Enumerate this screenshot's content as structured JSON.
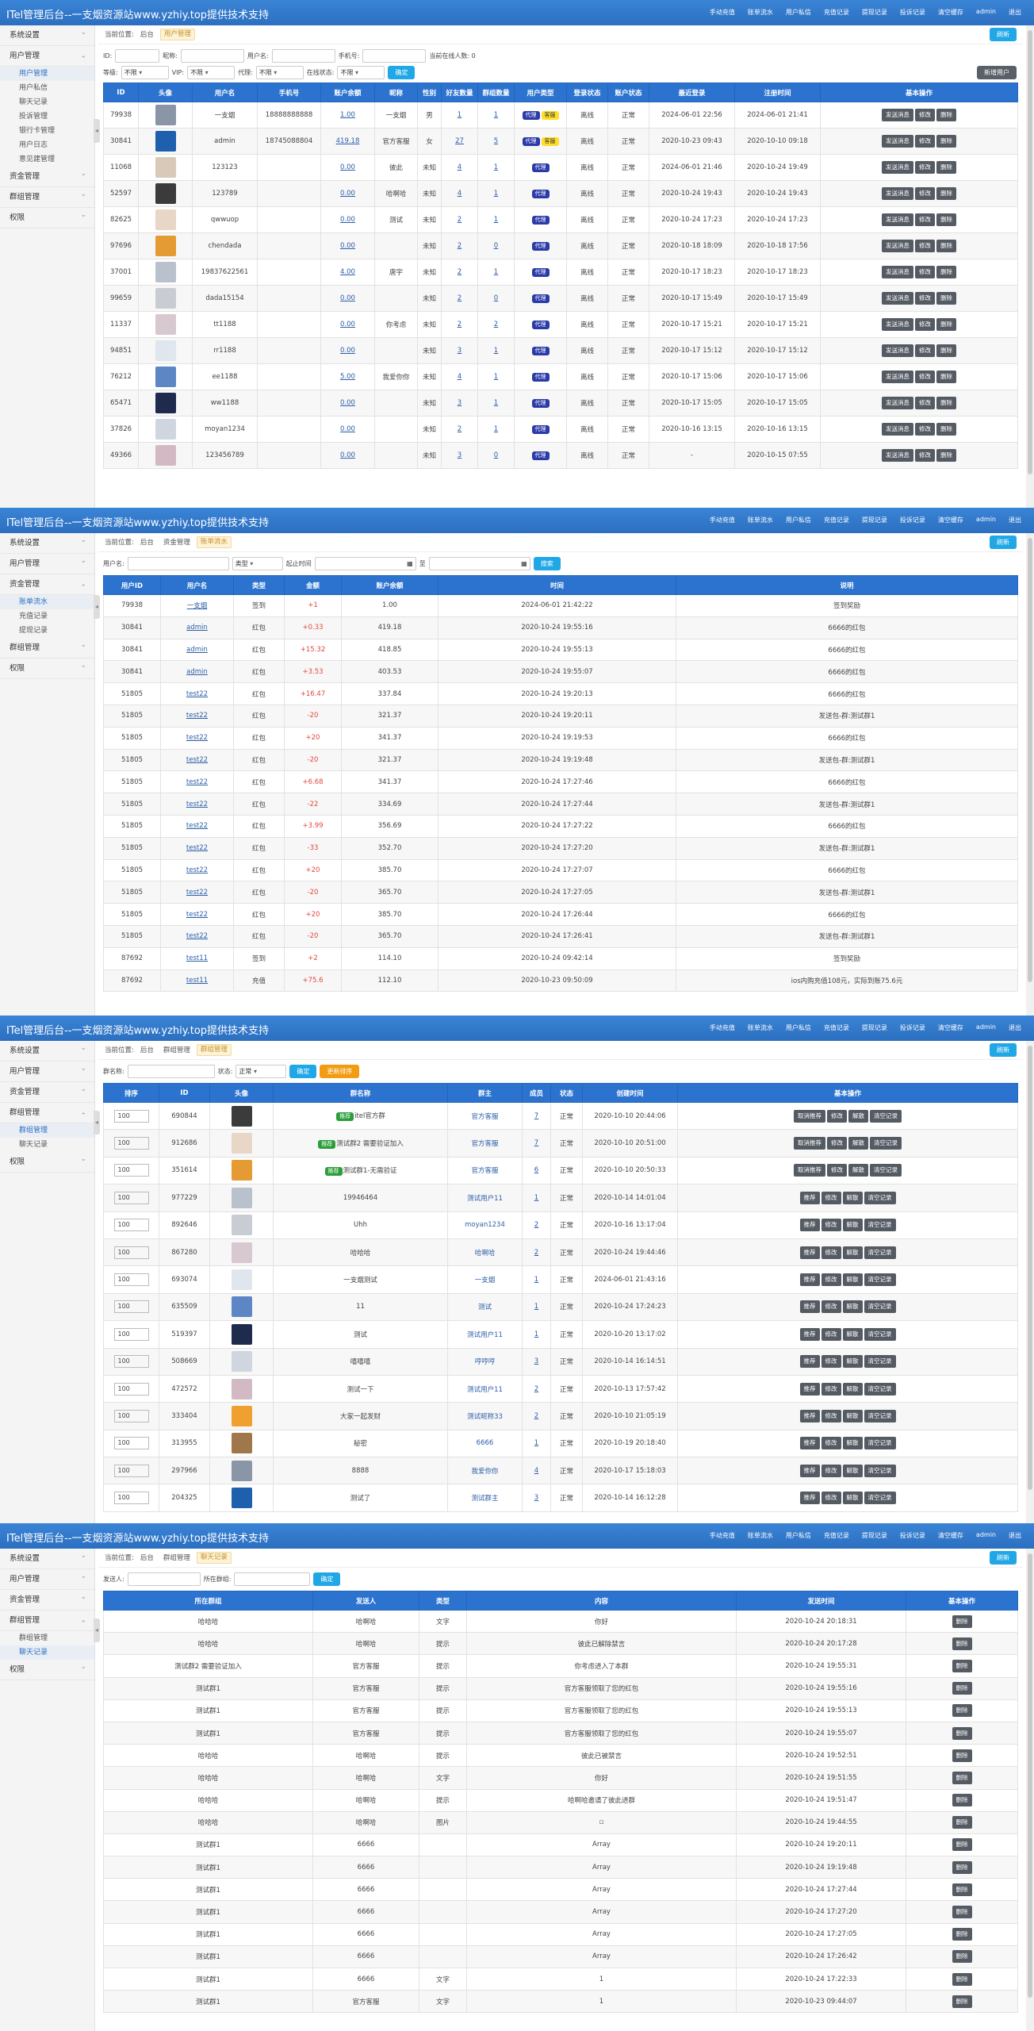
{
  "app": {
    "title": "ITel管理后台--一支烟资源站www.yzhiy.top提供技术支持",
    "nav": [
      "手动充值",
      "账单流水",
      "用户私信",
      "充值记录",
      "提现记录",
      "投诉记录",
      "清空缓存",
      "admin",
      "退出"
    ],
    "refresh": "刷新",
    "crumb_label": "当前位置:"
  },
  "sidebar": {
    "groups": [
      "系统设置",
      "用户管理",
      "资金管理",
      "群组管理",
      "权限"
    ],
    "user_items": [
      "用户管理",
      "用户私信",
      "聊天记录",
      "投诉管理",
      "银行卡管理",
      "用户日志",
      "意见建管理"
    ],
    "fund_items": [
      "账单流水",
      "充值记录",
      "提现记录"
    ],
    "group_items": [
      "群组管理",
      "聊天记录"
    ]
  },
  "s1": {
    "crumbs": [
      "后台",
      "用户管理"
    ],
    "filters": {
      "id": "ID:",
      "nick": "昵称:",
      "user": "用户名:",
      "phone": "手机号:",
      "online": "当前在线人数: 0",
      "level": "等级:",
      "vip": "VIP:",
      "proxy": "代理:",
      "status": "在线状态:",
      "any": "不限",
      "confirm": "确定",
      "add": "新增用户"
    },
    "headers": [
      "ID",
      "头像",
      "用户名",
      "手机号",
      "账户余额",
      "昵称",
      "性别",
      "好友数量",
      "群组数量",
      "用户类型",
      "登录状态",
      "账户状态",
      "最近登录",
      "注册时间",
      "基本操作"
    ],
    "ops": [
      "发送消息",
      "修改",
      "删除"
    ],
    "rows": [
      [
        "79938",
        "一支烟",
        "18888888888",
        "1.00",
        "一支烟",
        "男",
        "1",
        "1",
        "代理",
        "客服",
        "离线",
        "正常",
        "2024-06-01 22:56",
        "2024-06-01 21:41"
      ],
      [
        "30841",
        "admin",
        "18745088804",
        "419.18",
        "官方客服",
        "女",
        "27",
        "5",
        "代理",
        "客服",
        "离线",
        "正常",
        "2020-10-23 09:43",
        "2020-10-10 09:18"
      ],
      [
        "11068",
        "123123",
        "",
        "0.00",
        "彼此",
        "未知",
        "4",
        "1",
        "代理",
        "",
        "离线",
        "正常",
        "2024-06-01 21:46",
        "2020-10-24 19:49"
      ],
      [
        "52597",
        "123789",
        "",
        "0.00",
        "哈啊哈",
        "未知",
        "4",
        "1",
        "代理",
        "",
        "离线",
        "正常",
        "2020-10-24 19:43",
        "2020-10-24 19:43"
      ],
      [
        "82625",
        "qwwuop",
        "",
        "0.00",
        "测试",
        "未知",
        "2",
        "1",
        "代理",
        "",
        "离线",
        "正常",
        "2020-10-24 17:23",
        "2020-10-24 17:23"
      ],
      [
        "97696",
        "chendada",
        "",
        "0.00",
        "",
        "未知",
        "2",
        "0",
        "代理",
        "",
        "离线",
        "正常",
        "2020-10-18 18:09",
        "2020-10-18 17:56"
      ],
      [
        "37001",
        "19837622561",
        "",
        "4.00",
        "唐宇",
        "未知",
        "2",
        "1",
        "代理",
        "",
        "离线",
        "正常",
        "2020-10-17 18:23",
        "2020-10-17 18:23"
      ],
      [
        "99659",
        "dada15154",
        "",
        "0.00",
        "",
        "未知",
        "2",
        "0",
        "代理",
        "",
        "离线",
        "正常",
        "2020-10-17 15:49",
        "2020-10-17 15:49"
      ],
      [
        "11337",
        "tt1188",
        "",
        "0.00",
        "你考虑",
        "未知",
        "2",
        "2",
        "代理",
        "",
        "离线",
        "正常",
        "2020-10-17 15:21",
        "2020-10-17 15:21"
      ],
      [
        "94851",
        "rr1188",
        "",
        "0.00",
        "",
        "未知",
        "3",
        "1",
        "代理",
        "",
        "离线",
        "正常",
        "2020-10-17 15:12",
        "2020-10-17 15:12"
      ],
      [
        "76212",
        "ee1188",
        "",
        "5.00",
        "我爱你你",
        "未知",
        "4",
        "1",
        "代理",
        "",
        "离线",
        "正常",
        "2020-10-17 15:06",
        "2020-10-17 15:06"
      ],
      [
        "65471",
        "ww1188",
        "",
        "0.00",
        "",
        "未知",
        "3",
        "1",
        "代理",
        "",
        "离线",
        "正常",
        "2020-10-17 15:05",
        "2020-10-17 15:05"
      ],
      [
        "37826",
        "moyan1234",
        "",
        "0.00",
        "",
        "未知",
        "2",
        "1",
        "代理",
        "",
        "离线",
        "正常",
        "2020-10-16 13:15",
        "2020-10-16 13:15"
      ],
      [
        "49366",
        "123456789",
        "",
        "0.00",
        "",
        "未知",
        "3",
        "0",
        "代理",
        "",
        "离线",
        "正常",
        "-",
        "2020-10-15 07:55"
      ]
    ]
  },
  "s2": {
    "crumbs": [
      "后台",
      "资金管理",
      "账单流水"
    ],
    "filters": {
      "user": "用户名:",
      "type": "类型",
      "start": "起止时间",
      "to": "至",
      "search": "搜索"
    },
    "headers": [
      "用户ID",
      "用户名",
      "类型",
      "金额",
      "账户余额",
      "时间",
      "说明"
    ],
    "rows": [
      [
        "79938",
        "一支烟",
        "签到",
        "+1",
        "1.00",
        "2024-06-01 21:42:22",
        "签到奖励"
      ],
      [
        "30841",
        "admin",
        "红包",
        "+0.33",
        "419.18",
        "2020-10-24 19:55:16",
        "6666的红包"
      ],
      [
        "30841",
        "admin",
        "红包",
        "+15.32",
        "418.85",
        "2020-10-24 19:55:13",
        "6666的红包"
      ],
      [
        "30841",
        "admin",
        "红包",
        "+3.53",
        "403.53",
        "2020-10-24 19:55:07",
        "6666的红包"
      ],
      [
        "51805",
        "test22",
        "红包",
        "+16.47",
        "337.84",
        "2020-10-24 19:20:13",
        "6666的红包"
      ],
      [
        "51805",
        "test22",
        "红包",
        "-20",
        "321.37",
        "2020-10-24 19:20:11",
        "发送包-群:测试群1"
      ],
      [
        "51805",
        "test22",
        "红包",
        "+20",
        "341.37",
        "2020-10-24 19:19:53",
        "6666的红包"
      ],
      [
        "51805",
        "test22",
        "红包",
        "-20",
        "321.37",
        "2020-10-24 19:19:48",
        "发送包-群:测试群1"
      ],
      [
        "51805",
        "test22",
        "红包",
        "+6.68",
        "341.37",
        "2020-10-24 17:27:46",
        "6666的红包"
      ],
      [
        "51805",
        "test22",
        "红包",
        "-22",
        "334.69",
        "2020-10-24 17:27:44",
        "发送包-群:测试群1"
      ],
      [
        "51805",
        "test22",
        "红包",
        "+3.99",
        "356.69",
        "2020-10-24 17:27:22",
        "6666的红包"
      ],
      [
        "51805",
        "test22",
        "红包",
        "-33",
        "352.70",
        "2020-10-24 17:27:20",
        "发送包-群:测试群1"
      ],
      [
        "51805",
        "test22",
        "红包",
        "+20",
        "385.70",
        "2020-10-24 17:27:07",
        "6666的红包"
      ],
      [
        "51805",
        "test22",
        "红包",
        "-20",
        "365.70",
        "2020-10-24 17:27:05",
        "发送包-群:测试群1"
      ],
      [
        "51805",
        "test22",
        "红包",
        "+20",
        "385.70",
        "2020-10-24 17:26:44",
        "6666的红包"
      ],
      [
        "51805",
        "test22",
        "红包",
        "-20",
        "365.70",
        "2020-10-24 17:26:41",
        "发送包-群:测试群1"
      ],
      [
        "87692",
        "test11",
        "签到",
        "+2",
        "114.10",
        "2020-10-24 09:42:14",
        "签到奖励"
      ],
      [
        "87692",
        "test11",
        "充值",
        "+75.6",
        "112.10",
        "2020-10-23 09:50:09",
        "ios内购充值108元，实际到账75.6元"
      ]
    ]
  },
  "s3": {
    "crumbs": [
      "后台",
      "群组管理",
      "群组管理"
    ],
    "filters": {
      "name": "群名称:",
      "state": "状态:",
      "state_val": "正常",
      "confirm": "确定",
      "sort": "更新排序"
    },
    "headers": [
      "排序",
      "ID",
      "头像",
      "群名称",
      "群主",
      "成员",
      "状态",
      "创建时间",
      "基本操作"
    ],
    "ops_rec": [
      "取消推荐",
      "修改",
      "解散",
      "清空记录"
    ],
    "ops_norm": [
      "推荐",
      "修改",
      "解散",
      "清空记录"
    ],
    "rec_tag": "推荐",
    "rows": [
      [
        "100",
        "690844",
        "itel官方群",
        "官方客服",
        "7",
        "正常",
        "2020-10-10 20:44:06",
        "1"
      ],
      [
        "100",
        "912686",
        "测试群2 需要验证加入",
        "官方客服",
        "7",
        "正常",
        "2020-10-10 20:51:00",
        "1"
      ],
      [
        "100",
        "351614",
        "测试群1-无需验证",
        "官方客服",
        "6",
        "正常",
        "2020-10-10 20:50:33",
        "1"
      ],
      [
        "100",
        "977229",
        "19946464",
        "测试用户11",
        "1",
        "正常",
        "2020-10-14 14:01:04",
        "0"
      ],
      [
        "100",
        "892646",
        "Uhh",
        "moyan1234",
        "2",
        "正常",
        "2020-10-16 13:17:04",
        "0"
      ],
      [
        "100",
        "867280",
        "哈哈哈",
        "哈啊哈",
        "2",
        "正常",
        "2020-10-24 19:44:46",
        "0"
      ],
      [
        "100",
        "693074",
        "一支烟测试",
        "一支烟",
        "1",
        "正常",
        "2024-06-01 21:43:16",
        "0"
      ],
      [
        "100",
        "635509",
        "11",
        "测试",
        "1",
        "正常",
        "2020-10-24 17:24:23",
        "0"
      ],
      [
        "100",
        "519397",
        "测试",
        "测试用户11",
        "1",
        "正常",
        "2020-10-20 13:17:02",
        "0"
      ],
      [
        "100",
        "508669",
        "嘻嘻嘻",
        "哼哼哼",
        "3",
        "正常",
        "2020-10-14 16:14:51",
        "0"
      ],
      [
        "100",
        "472572",
        "测试一下",
        "测试用户11",
        "2",
        "正常",
        "2020-10-13 17:57:42",
        "0"
      ],
      [
        "100",
        "333404",
        "大家一起发财",
        "测试昵称33",
        "2",
        "正常",
        "2020-10-10 21:05:19",
        "0"
      ],
      [
        "100",
        "313955",
        "秘密",
        "6666",
        "1",
        "正常",
        "2020-10-19 20:18:40",
        "0"
      ],
      [
        "100",
        "297966",
        "8888",
        "我爱你你",
        "4",
        "正常",
        "2020-10-17 15:18:03",
        "0"
      ],
      [
        "100",
        "204325",
        "测试了",
        "测试群主",
        "3",
        "正常",
        "2020-10-14 16:12:28",
        "0"
      ]
    ]
  },
  "s4": {
    "crumbs": [
      "后台",
      "群组管理",
      "聊天记录"
    ],
    "filters": {
      "sender": "发送人:",
      "group": "所在群组:",
      "confirm": "确定"
    },
    "headers": [
      "所在群组",
      "发送人",
      "类型",
      "内容",
      "发送时间",
      "基本操作"
    ],
    "op": "删除",
    "rows": [
      [
        "哈哈哈",
        "哈啊哈",
        "文字",
        "你好",
        "2020-10-24 20:18:31"
      ],
      [
        "哈哈哈",
        "哈啊哈",
        "提示",
        "彼此已解除禁言",
        "2020-10-24 20:17:28"
      ],
      [
        "测试群2 需要验证加入",
        "官方客服",
        "提示",
        "你考虑进入了本群",
        "2020-10-24 19:55:31"
      ],
      [
        "测试群1",
        "官方客服",
        "提示",
        "官方客服领取了您的红包",
        "2020-10-24 19:55:16"
      ],
      [
        "测试群1",
        "官方客服",
        "提示",
        "官方客服领取了您的红包",
        "2020-10-24 19:55:13"
      ],
      [
        "测试群1",
        "官方客服",
        "提示",
        "官方客服领取了您的红包",
        "2020-10-24 19:55:07"
      ],
      [
        "哈哈哈",
        "哈啊哈",
        "提示",
        "彼此已被禁言",
        "2020-10-24 19:52:51"
      ],
      [
        "哈哈哈",
        "哈啊哈",
        "文字",
        "你好",
        "2020-10-24 19:51:55"
      ],
      [
        "哈哈哈",
        "哈啊哈",
        "提示",
        "哈啊哈邀请了彼此进群",
        "2020-10-24 19:51:47"
      ],
      [
        "哈哈哈",
        "哈啊哈",
        "图片",
        "",
        "2020-10-24 19:44:55"
      ],
      [
        "测试群1",
        "6666",
        "",
        "Array",
        "2020-10-24 19:20:11"
      ],
      [
        "测试群1",
        "6666",
        "",
        "Array",
        "2020-10-24 19:19:48"
      ],
      [
        "测试群1",
        "6666",
        "",
        "Array",
        "2020-10-24 17:27:44"
      ],
      [
        "测试群1",
        "6666",
        "",
        "Array",
        "2020-10-24 17:27:20"
      ],
      [
        "测试群1",
        "6666",
        "",
        "Array",
        "2020-10-24 17:27:05"
      ],
      [
        "测试群1",
        "6666",
        "",
        "Array",
        "2020-10-24 17:26:42"
      ],
      [
        "测试群1",
        "6666",
        "文字",
        "1",
        "2020-10-24 17:22:33"
      ],
      [
        "测试群1",
        "官方客服",
        "文字",
        "1",
        "2020-10-23 09:44:07"
      ]
    ]
  }
}
